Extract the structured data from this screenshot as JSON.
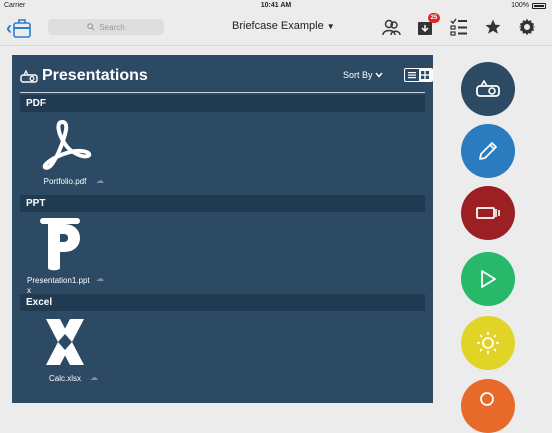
{
  "status": {
    "carrier": "Carrier",
    "time": "10:41 AM",
    "battery": "100%"
  },
  "nav": {
    "search_placeholder": "Search",
    "title": "Briefcase Example",
    "notification_count": "25"
  },
  "panel": {
    "title": "Presentations",
    "sort_label": "Sort By"
  },
  "sections": [
    {
      "label": "PDF",
      "files": [
        {
          "name": "Portfolio.pdf",
          "icon": "adobe-pdf-icon"
        }
      ]
    },
    {
      "label": "PPT",
      "files": [
        {
          "name": "Presentation1.pptx",
          "icon": "powerpoint-icon"
        }
      ]
    },
    {
      "label": "Excel",
      "files": [
        {
          "name": "Calc.xlsx",
          "icon": "excel-icon"
        }
      ]
    }
  ],
  "actions": [
    {
      "name": "present",
      "icon": "projector-icon",
      "color": "#2c4a63"
    },
    {
      "name": "edit",
      "icon": "pencil-icon",
      "color": "#2b7bbf"
    },
    {
      "name": "slides",
      "icon": "slides-icon",
      "color": "#9b1f23"
    },
    {
      "name": "play",
      "icon": "play-icon",
      "color": "#27b86a"
    },
    {
      "name": "brightness",
      "icon": "sun-icon",
      "color": "#e2d327"
    },
    {
      "name": "search",
      "icon": "search-icon",
      "color": "#e86a2a"
    }
  ]
}
